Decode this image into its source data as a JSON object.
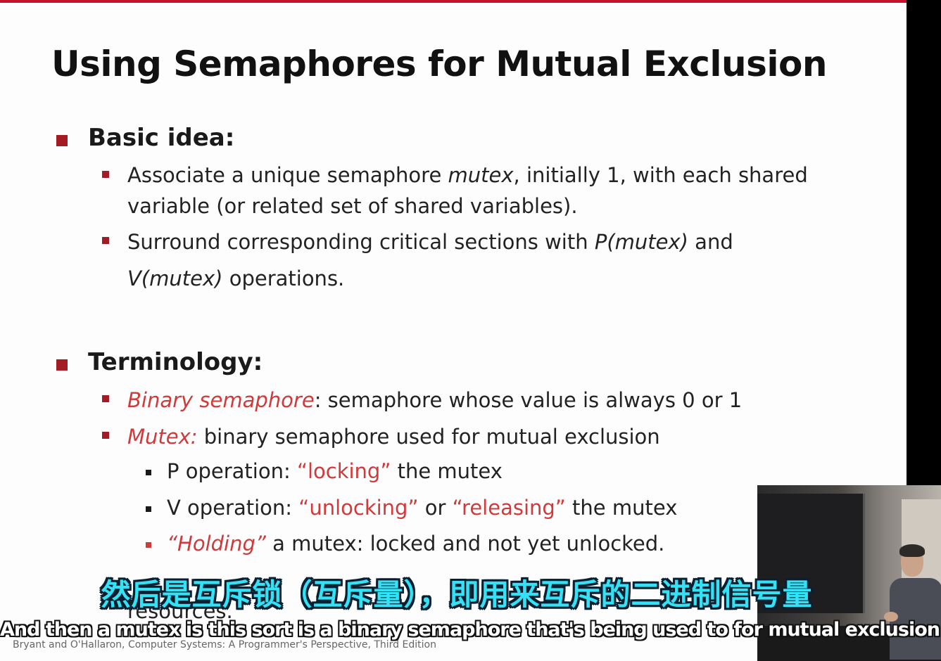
{
  "slide": {
    "title": "Using Semaphores for Mutual Exclusion",
    "basic": {
      "heading": "Basic idea:",
      "b1a_pre": "Associate a unique semaphore ",
      "b1a_it": "mutex",
      "b1a_post": ", initially 1, with each shared",
      "b1b": "variable (or related set of shared variables).",
      "b2a_pre": "Surround corresponding critical sections with ",
      "b2a_it": "P(mutex)",
      "b2a_post": " and",
      "b2b_it": "V(mutex)",
      "b2b_post": " operations."
    },
    "term": {
      "heading": "Terminology:",
      "t1_red": "Binary semaphore",
      "t1_rest": ": semaphore whose value is always 0 or 1",
      "t2_red": "Mutex:",
      "t2_rest": " binary semaphore used for mutual exclusion",
      "p_pre": "P operation: ",
      "p_red": "“locking”",
      "p_post": " the mutex",
      "v_pre": "V operation: ",
      "v_red1": "“unlocking”",
      "v_mid": " or ",
      "v_red2": "“releasing”",
      "v_post": " the mutex",
      "h_red": "“Holding”",
      "h_post": " a mutex: locked and not yet unlocked.",
      "t3_visible": "resources."
    },
    "footer": "Bryant and O'Hallaron, Computer Systems: A Programmer's Perspective, Third Edition"
  },
  "subtitles": {
    "zh": "然后是互斥锁（互斥量），即用来互斥的二进制信号量",
    "en": "And then a mutex is this sort is a binary semaphore that's being used to for mutual exclusion"
  },
  "colors": {
    "accent_red": "#c8102e",
    "bullet_red": "#a31c24",
    "term_red": "#d03a3a",
    "subtitle_cyan": "#35e1f5"
  }
}
